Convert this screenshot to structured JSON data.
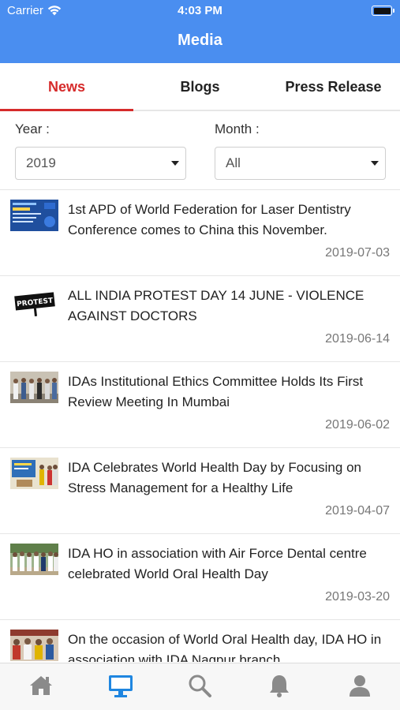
{
  "status": {
    "carrier": "Carrier",
    "time": "4:03 PM"
  },
  "header": {
    "title": "Media"
  },
  "tabs": [
    {
      "label": "News",
      "active": true
    },
    {
      "label": "Blogs",
      "active": false
    },
    {
      "label": "Press Release",
      "active": false
    }
  ],
  "filters": {
    "year_label": "Year :",
    "year_value": "2019",
    "month_label": "Month :",
    "month_value": "All"
  },
  "news": [
    {
      "title": "1st APD of World Federation for Laser Dentistry Conference comes to China this November.",
      "date": "2019-07-03",
      "thumb": "conference-banner"
    },
    {
      "title": "ALL INDIA PROTEST DAY 14 JUNE - VIOLENCE AGAINST DOCTORS",
      "date": "2019-06-14",
      "thumb": "protest-sign",
      "thumb_text": "PROTEST"
    },
    {
      "title": "IDAs Institutional Ethics Committee Holds Its First Review Meeting In Mumbai",
      "date": "2019-06-02",
      "thumb": "group-photo"
    },
    {
      "title": "IDA Celebrates World Health Day by Focusing on Stress Management for a Healthy Life",
      "date": "2019-04-07",
      "thumb": "event-photo"
    },
    {
      "title": "IDA HO in association with Air Force Dental centre celebrated World Oral Health Day",
      "date": "2019-03-20",
      "thumb": "group-photo-outdoor"
    },
    {
      "title": "On the occasion of World Oral Health day, IDA HO in association with IDA Nagpur branch",
      "date": "",
      "thumb": "crowd-photo"
    }
  ],
  "bottom_nav": [
    {
      "name": "home-icon",
      "active": false
    },
    {
      "name": "media-monitor-icon",
      "active": true
    },
    {
      "name": "search-icon",
      "active": false
    },
    {
      "name": "bell-icon",
      "active": false
    },
    {
      "name": "profile-icon",
      "active": false
    }
  ],
  "colors": {
    "header_bg": "#4a8ef0",
    "active_tab": "#d62b2b",
    "active_nav": "#1f86e0",
    "inactive_nav": "#8a8a8a"
  }
}
